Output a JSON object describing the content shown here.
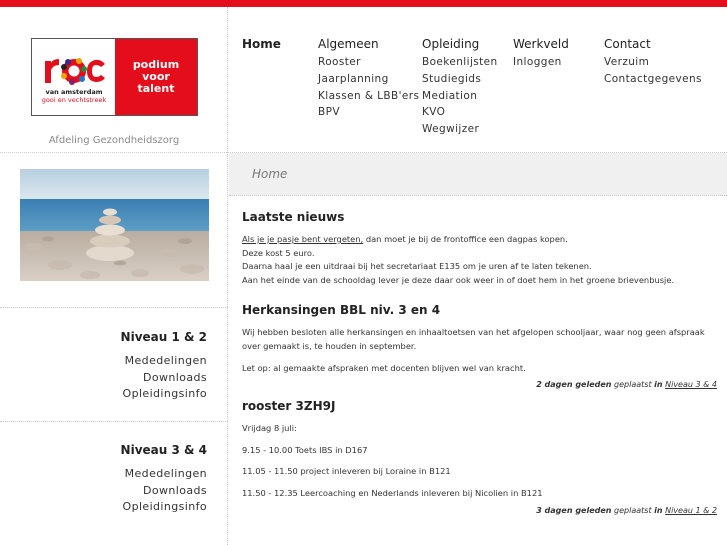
{
  "brand": {
    "logo_mark": "roc",
    "logo_line1": "van amsterdam",
    "logo_line2": "gooi en vechtstreek",
    "tagline": [
      "podium",
      "voor",
      "talent"
    ],
    "accent_color": "#e30d1c"
  },
  "department": "Afdeling Gezondheidszorg",
  "nav": {
    "home": "Home",
    "columns": [
      {
        "head": "Algemeen",
        "items": [
          "Rooster",
          "Jaarplanning",
          "Klassen & LBB'ers",
          "BPV"
        ]
      },
      {
        "head": "Opleiding",
        "items": [
          "Boekenlijsten",
          "Studiegids",
          "Mediation",
          "KVO",
          "Wegwijzer"
        ]
      },
      {
        "head": "Werkveld",
        "items": [
          "Inloggen"
        ]
      },
      {
        "head": "Contact",
        "items": [
          "Verzuim",
          "Contactgegevens"
        ]
      }
    ]
  },
  "breadcrumb": "Home",
  "sidebar": {
    "blocks": [
      {
        "title": "Niveau 1 & 2",
        "links": [
          "Mededelingen",
          "Downloads",
          "Opleidingsinfo"
        ]
      },
      {
        "title": "Niveau 3 & 4",
        "links": [
          "Mededelingen",
          "Downloads",
          "Opleidingsinfo"
        ]
      }
    ]
  },
  "posts": [
    {
      "title": "Laatste nieuws",
      "link_text": "Als je je pasje bent vergeten,",
      "lines": [
        " dan moet je bij de frontoffice een dagpas kopen.",
        "Deze kost 5 euro.",
        "Daarna haal je een uitdraai bij het secretariaat E135 om je uren af te laten tekenen.",
        "Aan het einde van de schooldag lever je deze daar ook weer in of doet hem in het groene brievenbusje."
      ]
    },
    {
      "title": "Herkansingen BBL niv. 3 en 4",
      "paragraphs": [
        "Wij hebben besloten alle herkansingen en inhaaltoetsen van het afgelopen schooljaar, waar nog geen afspraak over gemaakt is, te houden in september.",
        "Let op: al gemaakte afspraken met docenten blijven wel van kracht."
      ],
      "meta": {
        "age": "2 dagen geleden",
        "placed": "geplaatst",
        "in": "in",
        "category": "Niveau 3 & 4"
      }
    },
    {
      "title": "rooster 3ZH9J",
      "paragraphs": [
        "Vrijdag 8 juli:",
        "9.15 - 10.00 Toets IBS in D167",
        "11.05 - 11.50 project inleveren bij Loraine in B121",
        "11.50 - 12.35 Leercoaching en Nederlands inleveren bij Nicolien in B121"
      ],
      "meta": {
        "age": "3 dagen geleden",
        "placed": "geplaatst",
        "in": "in",
        "category": "Niveau 1 & 2"
      }
    }
  ]
}
